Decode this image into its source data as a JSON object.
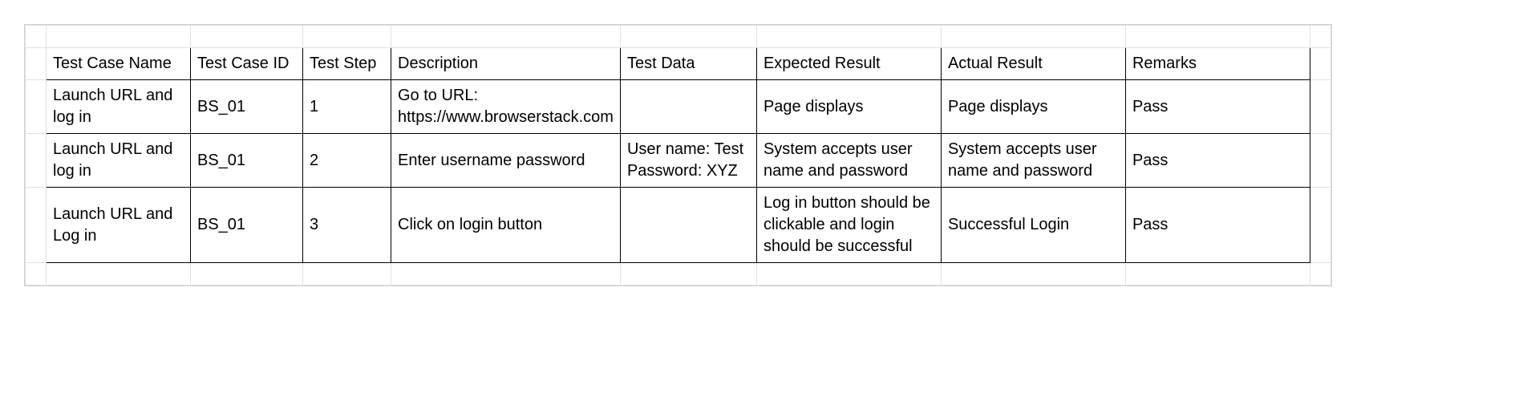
{
  "table": {
    "headers": {
      "name": "Test Case Name",
      "id": "Test Case ID",
      "step": "Test Step",
      "desc": "Description",
      "data": "Test Data",
      "expected": "Expected Result",
      "actual": "Actual Result",
      "remarks": "Remarks"
    },
    "rows": [
      {
        "name": "Launch URL and log in",
        "id": "BS_01",
        "step": "1",
        "desc": "Go to URL: https://www.browserstack.com",
        "data": "",
        "expected": "Page displays",
        "actual": "Page displays",
        "remarks": "Pass"
      },
      {
        "name": "Launch URL and log in",
        "id": "BS_01",
        "step": "2",
        "desc": "Enter username password",
        "data": "User name: Test\nPassword: XYZ",
        "expected": "System accepts user name and password",
        "actual": "System accepts user name and password",
        "remarks": "Pass"
      },
      {
        "name": "Launch URL and Log in",
        "id": "BS_01",
        "step": "3",
        "desc": "Click on login button",
        "data": "",
        "expected": "Log in button should be clickable and login should be successful",
        "actual": "Successful Login",
        "remarks": "Pass"
      }
    ]
  }
}
